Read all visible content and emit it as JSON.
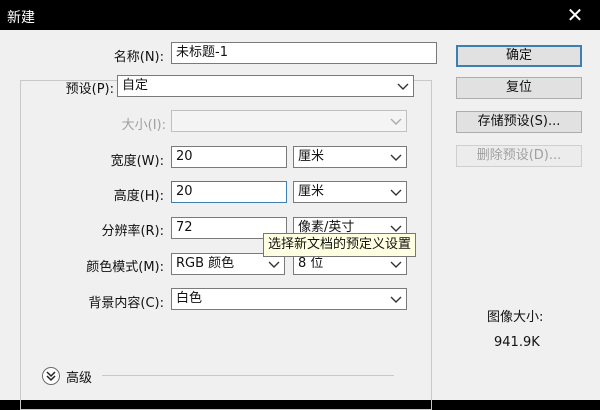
{
  "window": {
    "title": "新建",
    "close_glyph": "✕"
  },
  "form": {
    "name_label": "名称(N):",
    "name_value": "未标题-1",
    "preset_label": "预设(P):",
    "preset_value": "自定",
    "size_label": "大小(I):",
    "size_value": "",
    "width_label": "宽度(W):",
    "width_value": "20",
    "width_unit": "厘米",
    "height_label": "高度(H):",
    "height_value": "20",
    "height_unit": "厘米",
    "resolution_label": "分辨率(R):",
    "resolution_value": "72",
    "resolution_unit": "像素/英寸",
    "color_mode_label": "颜色模式(M):",
    "color_mode_value": "RGB 颜色",
    "bit_depth_value": "8 位",
    "background_label": "背景内容(C):",
    "background_value": "白色",
    "advanced_label": "高级"
  },
  "tooltip": {
    "text": "选择新文档的预定义设置"
  },
  "buttons": {
    "ok": "确定",
    "reset": "复位",
    "save_preset": "存储预设(S)...",
    "delete_preset": "删除预设(D)..."
  },
  "image_size": {
    "label": "图像大小:",
    "value": "941.9K"
  },
  "icons": {
    "dropdown": "chevron-down-icon",
    "advanced": "double-chevron-down-icon",
    "close": "close-icon"
  }
}
